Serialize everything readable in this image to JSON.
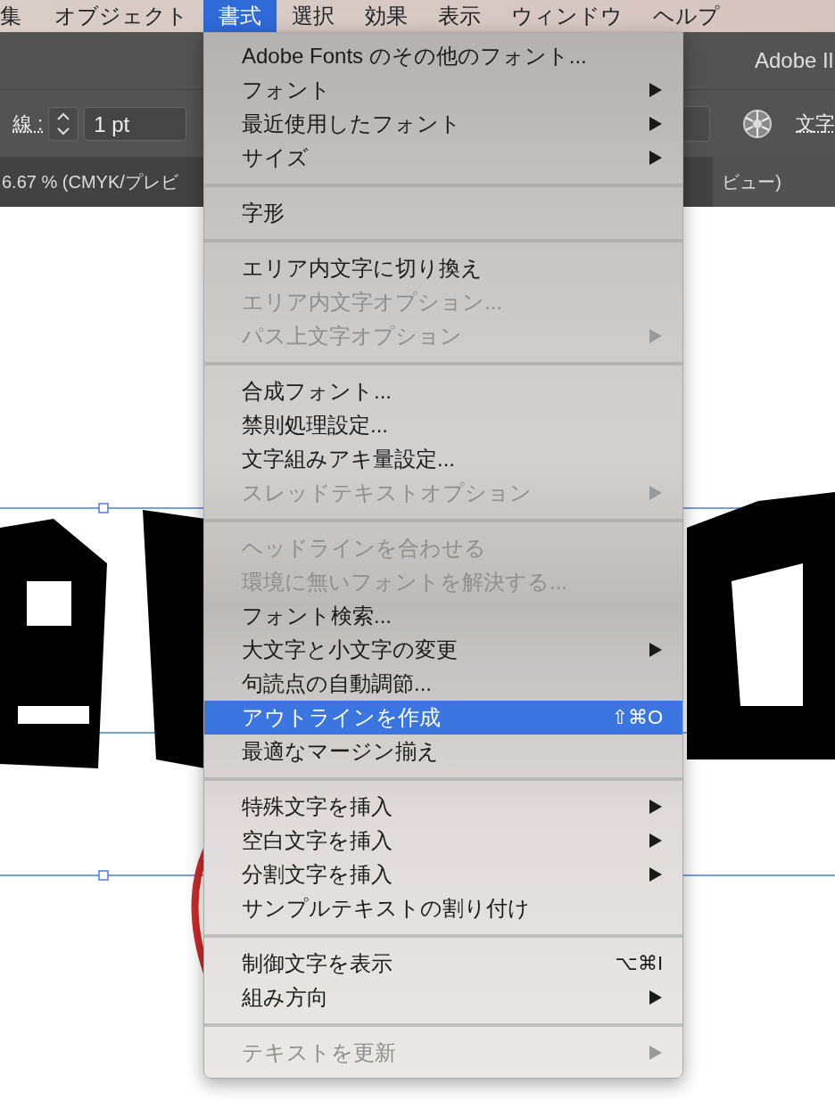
{
  "menubar": [
    {
      "label": "集",
      "selected": false
    },
    {
      "label": "オブジェクト",
      "selected": false
    },
    {
      "label": "書式",
      "selected": true
    },
    {
      "label": "選択",
      "selected": false
    },
    {
      "label": "効果",
      "selected": false
    },
    {
      "label": "表示",
      "selected": false
    },
    {
      "label": "ウィンドウ",
      "selected": false
    },
    {
      "label": "ヘルプ",
      "selected": false
    }
  ],
  "app_title": "Adobe Il",
  "control_bar": {
    "stroke_label": "線 :",
    "stroke_value": "1 pt",
    "right_label": "文字"
  },
  "document_tabs": [
    "6.67 % (CMYK/プレビ",
    "ビュー)"
  ],
  "menu": {
    "groups": [
      {
        "items": [
          {
            "label": "Adobe Fonts のその他のフォント...",
            "disabled": false,
            "selected": false,
            "submenu": false
          },
          {
            "label": "フォント",
            "disabled": false,
            "selected": false,
            "submenu": true
          },
          {
            "label": "最近使用したフォント",
            "disabled": false,
            "selected": false,
            "submenu": true
          },
          {
            "label": "サイズ",
            "disabled": false,
            "selected": false,
            "submenu": true
          }
        ]
      },
      {
        "items": [
          {
            "label": "字形",
            "disabled": false,
            "selected": false,
            "submenu": false
          }
        ]
      },
      {
        "items": [
          {
            "label": "エリア内文字に切り換え",
            "disabled": false,
            "selected": false,
            "submenu": false
          },
          {
            "label": "エリア内文字オプション...",
            "disabled": true,
            "selected": false,
            "submenu": false
          },
          {
            "label": "パス上文字オプション",
            "disabled": true,
            "selected": false,
            "submenu": true
          }
        ]
      },
      {
        "items": [
          {
            "label": "合成フォント...",
            "disabled": false,
            "selected": false,
            "submenu": false
          },
          {
            "label": "禁則処理設定...",
            "disabled": false,
            "selected": false,
            "submenu": false
          },
          {
            "label": "文字組みアキ量設定...",
            "disabled": false,
            "selected": false,
            "submenu": false
          },
          {
            "label": "スレッドテキストオプション",
            "disabled": true,
            "selected": false,
            "submenu": true
          }
        ]
      },
      {
        "items": [
          {
            "label": "ヘッドラインを合わせる",
            "disabled": true,
            "selected": false,
            "submenu": false
          },
          {
            "label": "環境に無いフォントを解決する...",
            "disabled": true,
            "selected": false,
            "submenu": false
          },
          {
            "label": "フォント検索...",
            "disabled": false,
            "selected": false,
            "submenu": false
          },
          {
            "label": "大文字と小文字の変更",
            "disabled": false,
            "selected": false,
            "submenu": true
          },
          {
            "label": "句読点の自動調節...",
            "disabled": false,
            "selected": false,
            "submenu": false
          },
          {
            "label": "アウトラインを作成",
            "disabled": false,
            "selected": true,
            "submenu": false,
            "shortcut": "⇧⌘O"
          },
          {
            "label": "最適なマージン揃え",
            "disabled": false,
            "selected": false,
            "submenu": false
          }
        ]
      },
      {
        "items": [
          {
            "label": "特殊文字を挿入",
            "disabled": false,
            "selected": false,
            "submenu": true
          },
          {
            "label": "空白文字を挿入",
            "disabled": false,
            "selected": false,
            "submenu": true
          },
          {
            "label": "分割文字を挿入",
            "disabled": false,
            "selected": false,
            "submenu": true
          },
          {
            "label": "サンプルテキストの割り付け",
            "disabled": false,
            "selected": false,
            "submenu": false
          }
        ]
      },
      {
        "items": [
          {
            "label": "制御文字を表示",
            "disabled": false,
            "selected": false,
            "submenu": false,
            "shortcut": "⌥⌘I"
          },
          {
            "label": "組み方向",
            "disabled": false,
            "selected": false,
            "submenu": true
          }
        ]
      },
      {
        "items": [
          {
            "label": "テキストを更新",
            "disabled": true,
            "selected": false,
            "submenu": true
          }
        ]
      }
    ]
  }
}
